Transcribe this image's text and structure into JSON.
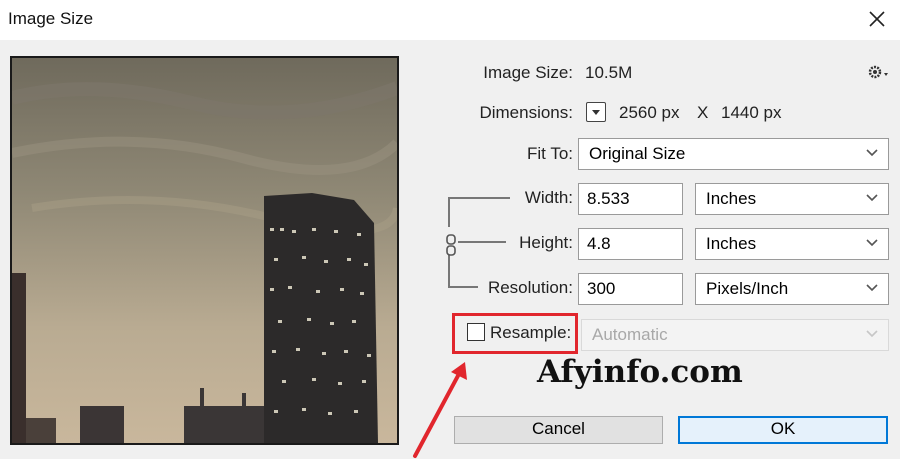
{
  "window": {
    "title": "Image Size"
  },
  "info": {
    "image_size_label": "Image Size:",
    "image_size_value": "10.5M",
    "dimensions_label": "Dimensions:",
    "dim_width": "2560 px",
    "dim_x": "X",
    "dim_height": "1440 px"
  },
  "fit_to": {
    "label": "Fit To:",
    "value": "Original Size"
  },
  "width": {
    "label": "Width:",
    "value": "8.533",
    "unit": "Inches"
  },
  "height": {
    "label": "Height:",
    "value": "4.8",
    "unit": "Inches"
  },
  "resolution": {
    "label": "Resolution:",
    "value": "300",
    "unit": "Pixels/Inch"
  },
  "resample": {
    "label": "Resample:",
    "checked": false,
    "method": "Automatic"
  },
  "watermark": "Afyinfo.com",
  "buttons": {
    "cancel": "Cancel",
    "ok": "OK"
  },
  "colors": {
    "annotation": "#e1262d",
    "ok_border": "#0078d7"
  }
}
